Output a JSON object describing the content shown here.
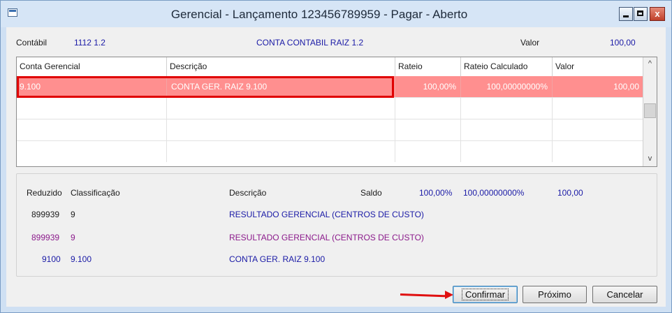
{
  "window": {
    "title": "Gerencial -  Lançamento 123456789959 - Pagar - Aberto",
    "close_glyph": "x"
  },
  "header": {
    "contabil_label": "Contábil",
    "contabil_code": "1112  1.2",
    "contabil_desc": "CONTA CONTABIL RAIZ 1.2",
    "valor_label": "Valor",
    "valor_value": "100,00"
  },
  "grid": {
    "columns": [
      "Conta Gerencial",
      "Descrição",
      "Rateio",
      "Rateio Calculado",
      "Valor"
    ],
    "rows": [
      {
        "conta": "9.100",
        "descricao": "CONTA GER. RAIZ 9.100",
        "rateio": "100,00%",
        "rateio_calc": "100,00000000%",
        "valor": "100,00",
        "selected": true
      }
    ],
    "scroll_up": "^",
    "scroll_down": "v"
  },
  "info": {
    "headers": {
      "reduzido": "Reduzido",
      "classificacao": "Classificação",
      "descricao": "Descrição",
      "saldo": "Saldo",
      "saldo_rateio": "100,00%",
      "saldo_rateio_calc": "100,00000000%",
      "saldo_valor": "100,00"
    },
    "rows": [
      {
        "reduzido": "899939",
        "classificacao": "9",
        "descricao": "RESULTADO GERENCIAL (CENTROS DE CUSTO)"
      },
      {
        "reduzido": "899939",
        "classificacao": "9",
        "descricao": "RESULTADO GERENCIAL (CENTROS DE CUSTO)"
      },
      {
        "reduzido": "9100",
        "classificacao": "9.100",
        "descricao": "CONTA GER. RAIZ 9.100"
      }
    ]
  },
  "buttons": {
    "confirmar": "Confirmar",
    "proximo": "Próximo",
    "cancelar": "Cancelar"
  },
  "colors": {
    "selected_row": "#ff8f8f",
    "highlight_box": "#e00000",
    "annotation_arrow": "#e01010",
    "link_blue": "#1a1aa6",
    "purple_row": "#8b1a8b"
  }
}
